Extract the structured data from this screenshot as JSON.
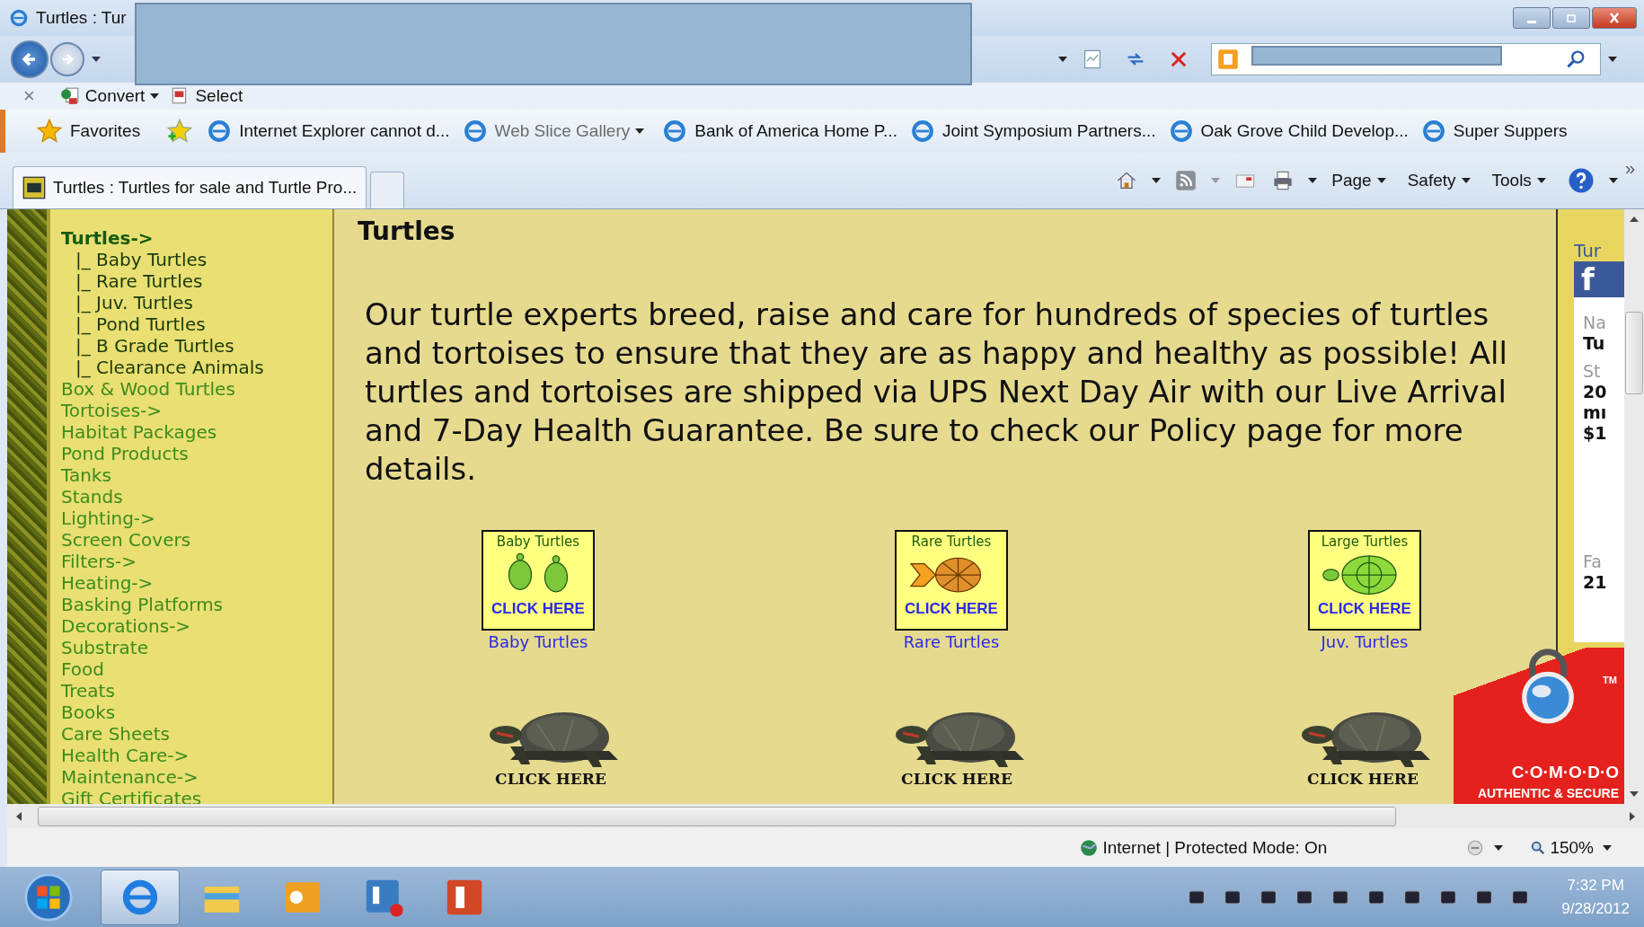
{
  "window": {
    "title": "Turtles : Tur"
  },
  "command_bar": {
    "close": "×",
    "items": [
      {
        "label": "Convert",
        "kind": "convert",
        "dropdown": true
      },
      {
        "label": "Select",
        "kind": "select",
        "dropdown": false
      }
    ]
  },
  "favorites_bar": {
    "label": "Favorites",
    "links": [
      {
        "label": "Internet Explorer cannot d...",
        "dropdown": false,
        "dimmed": false
      },
      {
        "label": "Web Slice Gallery",
        "dropdown": true,
        "dimmed": true
      },
      {
        "label": "Bank of America  Home  P...",
        "dropdown": false,
        "dimmed": false
      },
      {
        "label": "Joint Symposium Partners...",
        "dropdown": false,
        "dimmed": false
      },
      {
        "label": "Oak Grove Child Develop...",
        "dropdown": false,
        "dimmed": false
      },
      {
        "label": "Super Suppers",
        "dropdown": false,
        "dimmed": false
      }
    ],
    "more": "»"
  },
  "tabs": [
    {
      "label": "Turtles : Turtles for sale and Turtle Pro...",
      "selected": true
    }
  ],
  "tools": [
    "Page",
    "Safety",
    "Tools"
  ],
  "sidebar": {
    "items": [
      {
        "label": "Turtles->",
        "selected": true,
        "children": [
          {
            "label": "|_ Baby Turtles",
            "selected": false
          },
          {
            "label": "|_ Rare Turtles",
            "selected": false
          },
          {
            "label": "|_ Juv. Turtles",
            "selected": false
          },
          {
            "label": "|_ Pond Turtles",
            "selected": false
          },
          {
            "label": "|_ B Grade Turtles",
            "selected": false
          },
          {
            "label": "|_ Clearance Animals",
            "selected": false
          }
        ]
      },
      {
        "label": "Box & Wood Turtles",
        "selected": false
      },
      {
        "label": "Tortoises->",
        "selected": false
      },
      {
        "label": "Habitat Packages",
        "selected": false
      },
      {
        "label": "Pond Products",
        "selected": false
      },
      {
        "label": "Tanks",
        "selected": false
      },
      {
        "label": "Stands",
        "selected": false
      },
      {
        "label": "Lighting->",
        "selected": false
      },
      {
        "label": "Screen Covers",
        "selected": false
      },
      {
        "label": "Filters->",
        "selected": false
      },
      {
        "label": "Heating->",
        "selected": false
      },
      {
        "label": "Basking Platforms",
        "selected": false
      },
      {
        "label": "Decorations->",
        "selected": false
      },
      {
        "label": "Substrate",
        "selected": false
      },
      {
        "label": "Food",
        "selected": false
      },
      {
        "label": "Treats",
        "selected": false
      },
      {
        "label": "Books",
        "selected": false
      },
      {
        "label": "Care Sheets",
        "selected": false
      },
      {
        "label": "Health Care->",
        "selected": false
      },
      {
        "label": "Maintenance->",
        "selected": false
      },
      {
        "label": "Gift Certificates",
        "selected": false
      }
    ]
  },
  "page": {
    "heading": "Turtles",
    "intro": "Our turtle experts breed, raise and care for hundreds of species of turtles and tortoises to ensure that they are as happy and healthy as possible! All turtles and tortoises are shipped via UPS Next Day Air with our Live Arrival and 7-Day Health Guarantee. Be sure to check our Policy page for more details.",
    "categories": [
      {
        "kind": "baby",
        "banner_title": "Baby Turtles",
        "banner_button": "CLICK HERE",
        "caption": "Baby Turtles",
        "photo_button": "CLICK HERE"
      },
      {
        "kind": "rare",
        "banner_title": "Rare Turtles",
        "banner_button": "CLICK HERE",
        "caption": "Rare Turtles",
        "photo_button": "CLICK HERE"
      },
      {
        "kind": "large",
        "banner_title": "Large Turtles",
        "banner_button": "CLICK HERE",
        "caption": "Juv. Turtles",
        "photo_button": "CLICK HERE"
      }
    ]
  },
  "side_widget": {
    "title": "Tur",
    "logo": "f",
    "lines": [
      {
        "text": "Na",
        "kind": "label"
      },
      {
        "text": "Tu",
        "kind": "value"
      },
      {
        "text": "St",
        "kind": "label"
      },
      {
        "text": "20",
        "kind": "value"
      },
      {
        "text": "mı",
        "kind": "value"
      },
      {
        "text": "$1",
        "kind": "value"
      },
      {
        "text": "Fa",
        "kind": "label"
      },
      {
        "text": "21",
        "kind": "value"
      }
    ]
  },
  "seal": {
    "brand": "C·O·M·O·D·O",
    "tagline": "AUTHENTIC & SECURE",
    "tm": "TM"
  },
  "status_bar": {
    "zone": "Internet | Protected Mode: On",
    "zoom": "150%"
  },
  "taskbar": {
    "apps": [
      {
        "kind": "browser",
        "selected": true
      },
      {
        "kind": "folder",
        "selected": false
      },
      {
        "kind": "mail",
        "selected": false
      },
      {
        "kind": "chat",
        "selected": false
      },
      {
        "kind": "slides",
        "selected": false
      }
    ],
    "time": "7:32 PM",
    "date": "9/28/2012"
  }
}
